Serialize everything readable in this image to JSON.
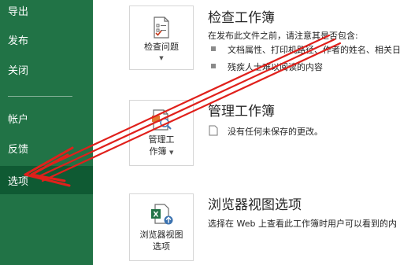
{
  "sidebar": {
    "items": [
      {
        "label": "导出"
      },
      {
        "label": "发布"
      },
      {
        "label": "关闭"
      },
      {
        "label": "帐户"
      },
      {
        "label": "反馈"
      },
      {
        "label": "选项"
      }
    ],
    "selected": "选项"
  },
  "inspect": {
    "button_label_line1": "检查问题",
    "title": "检查工作簿",
    "intro": "在发布此文件之前，请注意其是否包含:",
    "bullets": [
      "文档属性、打印机路径、作者的姓名、相关日",
      "残疾人士难以阅读的内容"
    ]
  },
  "manage": {
    "button_label_line1": "管理工",
    "button_label_line2": "作簿",
    "title": "管理工作簿",
    "status": "没有任何未保存的更改。"
  },
  "browser": {
    "button_label_line1": "浏览器视图",
    "button_label_line2": "选项",
    "title": "浏览器视图选项",
    "desc": "选择在 Web 上查看此工作簿时用户可以看到的内"
  },
  "colors": {
    "sidebar_bg": "#217346",
    "selected_bg": "#0f5a33",
    "annotation": "#e0201b"
  },
  "icons": {
    "inspect": "document-checklist-icon",
    "manage": "document-magnifier-icon",
    "browser": "excel-web-icon",
    "bullet": "square-bullet-icon",
    "status": "document-page-icon"
  }
}
